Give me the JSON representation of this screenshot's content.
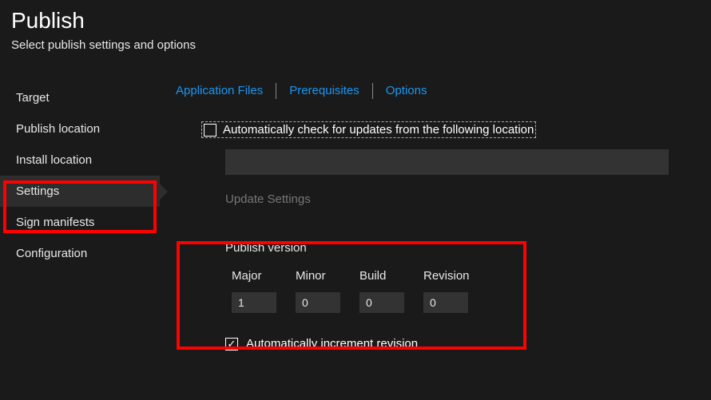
{
  "header": {
    "title": "Publish",
    "subtitle": "Select publish settings and options"
  },
  "sidebar": {
    "items": [
      {
        "label": "Target"
      },
      {
        "label": "Publish location"
      },
      {
        "label": "Install location"
      },
      {
        "label": "Settings"
      },
      {
        "label": "Sign manifests"
      },
      {
        "label": "Configuration"
      }
    ]
  },
  "tabs": {
    "app_files": "Application Files",
    "prerequisites": "Prerequisites",
    "options": "Options"
  },
  "updates": {
    "auto_check_label": "Automatically check for updates from the following location",
    "location_value": "",
    "update_settings": "Update Settings"
  },
  "version": {
    "title": "Publish version",
    "major_label": "Major",
    "minor_label": "Minor",
    "build_label": "Build",
    "revision_label": "Revision",
    "major": "1",
    "minor": "0",
    "build": "0",
    "revision": "0",
    "auto_increment_label": "Automatically increment revision"
  }
}
